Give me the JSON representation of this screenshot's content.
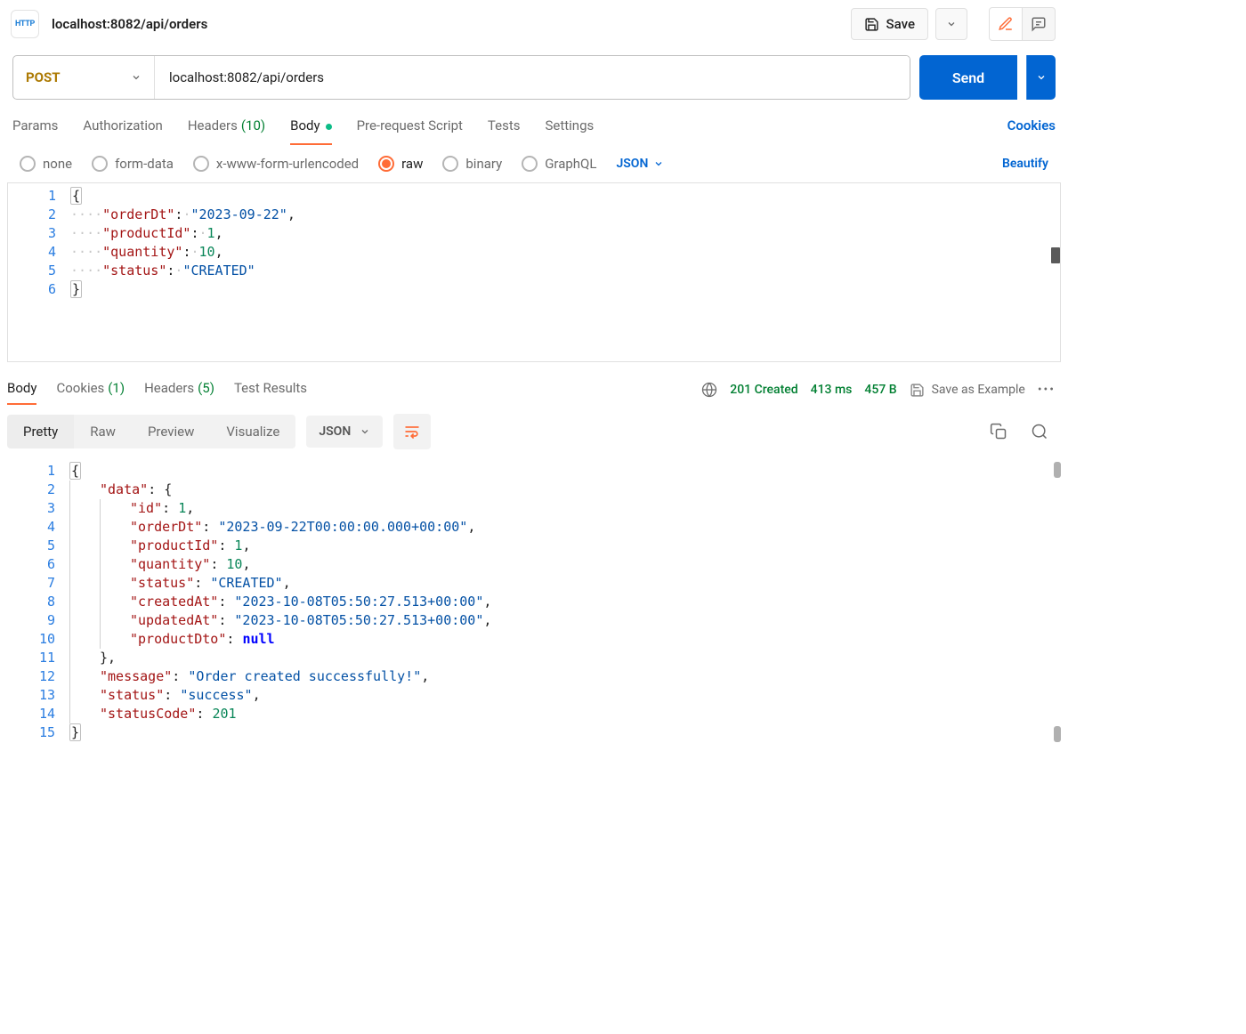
{
  "titlebar": {
    "badge": "HTTP",
    "title": "localhost:8082/api/orders",
    "save": "Save"
  },
  "request": {
    "method": "POST",
    "url": "localhost:8082/api/orders",
    "send": "Send",
    "tabs": {
      "params": "Params",
      "authorization": "Authorization",
      "headers": "Headers",
      "headers_count": "(10)",
      "body": "Body",
      "prerequest": "Pre-request Script",
      "tests": "Tests",
      "settings": "Settings"
    },
    "cookies_link": "Cookies",
    "body_types": {
      "none": "none",
      "form_data": "form-data",
      "x_www": "x-www-form-urlencoded",
      "raw": "raw",
      "binary": "binary",
      "graphql": "GraphQL",
      "format": "JSON",
      "beautify": "Beautify"
    },
    "payload": {
      "orderDt": "2023-09-22",
      "productId": 1,
      "quantity": 10,
      "status": "CREATED"
    }
  },
  "response": {
    "tabs": {
      "body": "Body",
      "cookies": "Cookies",
      "cookies_count": "(1)",
      "headers": "Headers",
      "headers_count": "(5)",
      "testresults": "Test Results"
    },
    "status": "201 Created",
    "time": "413 ms",
    "size": "457 B",
    "save_example": "Save as Example",
    "views": {
      "pretty": "Pretty",
      "raw": "Raw",
      "preview": "Preview",
      "visualize": "Visualize"
    },
    "format": "JSON",
    "body": {
      "data": {
        "id": 1,
        "orderDt": "2023-09-22T00:00:00.000+00:00",
        "productId": 1,
        "quantity": 10,
        "status": "CREATED",
        "createdAt": "2023-10-08T05:50:27.513+00:00",
        "updatedAt": "2023-10-08T05:50:27.513+00:00",
        "productDto": null
      },
      "message": "Order created successfully!",
      "status": "success",
      "statusCode": 201
    }
  }
}
